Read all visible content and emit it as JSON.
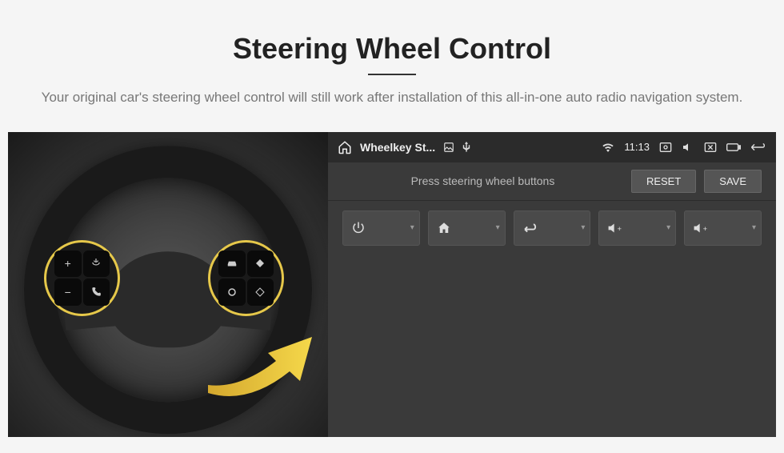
{
  "header": {
    "title": "Steering Wheel Control",
    "subtitle": "Your original car's steering wheel control will still work after installation of this all-in-one auto radio navigation system."
  },
  "wheel": {
    "left_buttons": [
      "plus-icon",
      "voice-icon",
      "minus-icon",
      "phone-icon"
    ],
    "right_buttons": [
      "car-icon",
      "diamond-icon",
      "circle-icon",
      "diamond-outline-icon"
    ]
  },
  "status_bar": {
    "home_icon": "home-icon",
    "app_title": "Wheelkey St...",
    "indicators": [
      "image-icon",
      "usb-icon"
    ],
    "right_icons": [
      "wifi-icon"
    ],
    "time": "11:13",
    "tray_icons": [
      "screenshot-icon",
      "mute-icon",
      "close-app-icon",
      "battery-icon",
      "back-icon"
    ]
  },
  "instruction": {
    "text": "Press steering wheel buttons",
    "reset_label": "RESET",
    "save_label": "SAVE"
  },
  "functions": [
    {
      "name": "power",
      "icon": "power-icon"
    },
    {
      "name": "home",
      "icon": "home-icon"
    },
    {
      "name": "back",
      "icon": "return-icon"
    },
    {
      "name": "vol-up-1",
      "icon": "volume-up-icon"
    },
    {
      "name": "vol-up-2",
      "icon": "volume-up-icon"
    }
  ],
  "colors": {
    "highlight": "#e6c84a",
    "arrow": "#f0c838",
    "screen_bg": "#3a3a3a",
    "btn_bg": "#4a4a4a"
  }
}
